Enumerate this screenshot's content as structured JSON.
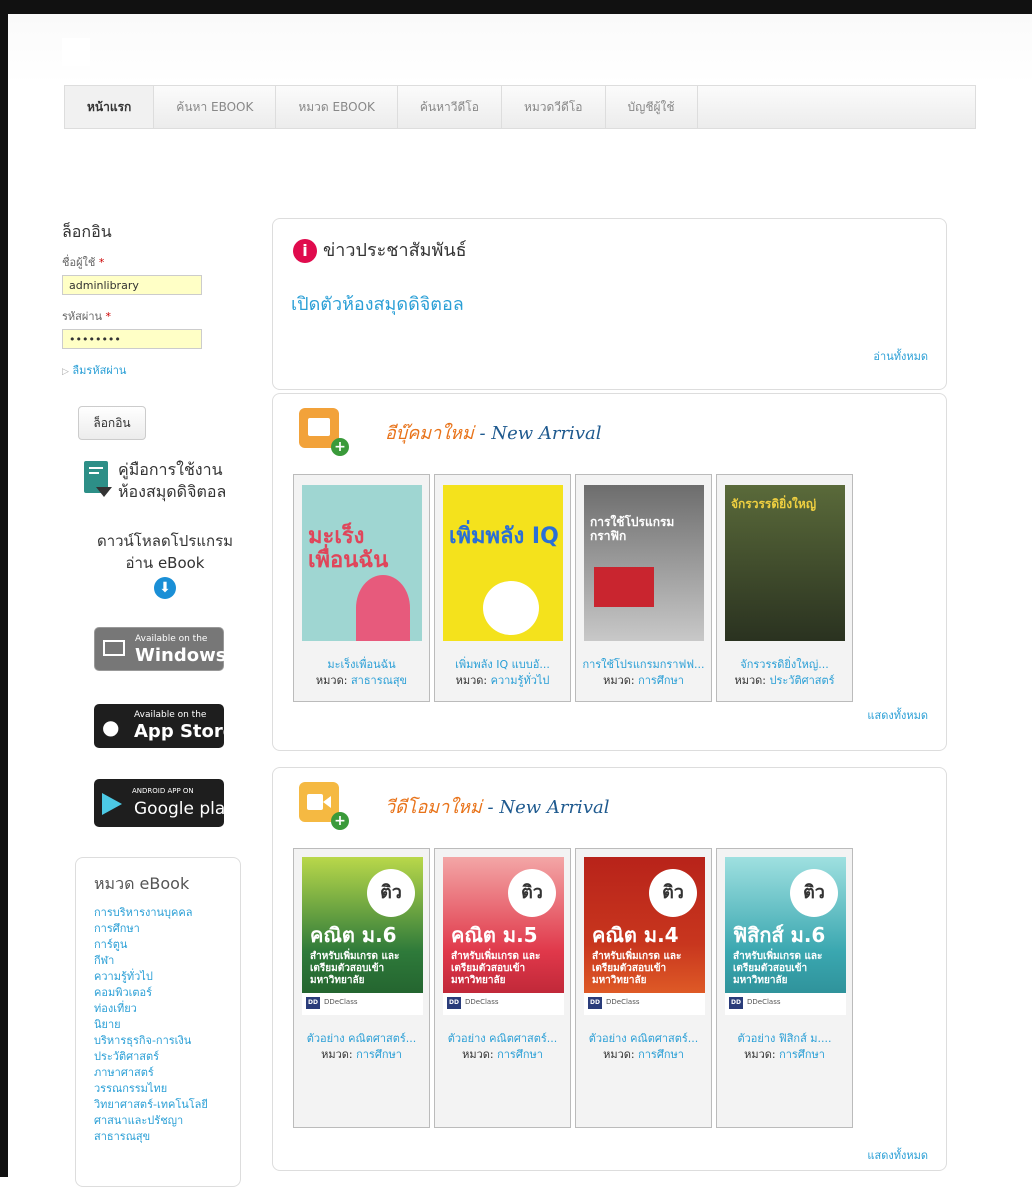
{
  "nav": [
    "หน้าแรก",
    "ค้นหา EBOOK",
    "หมวด EBOOK",
    "ค้นหาวีดีโอ",
    "หมวดวีดีโอ",
    "บัญชีผู้ใช้"
  ],
  "login": {
    "title": "ล็อกอิน",
    "username_label": "ชื่อผู้ใช้",
    "username_value": "adminlibrary",
    "password_label": "รหัสผ่าน",
    "password_value": "••••••••",
    "required_mark": "*",
    "forgot": "ลืมรหัสผ่าน",
    "button": "ล็อกอิน"
  },
  "manual": {
    "line1": "คู่มือการใช้งาน",
    "line2": "ห้องสมุดดิจิตอล"
  },
  "download": {
    "line1": "ดาวน์โหลดโปรแกรม",
    "line2": "อ่าน eBook"
  },
  "stores": {
    "windows": {
      "small": "Available on the",
      "big": "Windows"
    },
    "apple": {
      "small": "Available on the",
      "big": "App Store"
    },
    "google": {
      "small": "ANDROID APP ON",
      "big": "Google play"
    }
  },
  "categories": {
    "title": "หมวด eBook",
    "items": [
      "การบริหารงานบุคคล",
      "การศึกษา",
      "การ์ตูน",
      "กีฬา",
      "ความรู้ทั่วไป",
      "คอมพิวเตอร์",
      "ท่องเที่ยว",
      "นิยาย",
      "บริหารธุรกิจ-การเงิน",
      "ประวัติศาสตร์",
      "ภาษาศาสตร์",
      "วรรณกรรมไทย",
      "วิทยาศาสตร์-เทคโนโลยี",
      "ศาสนาและปรัชญา",
      "สาธารณสุข"
    ]
  },
  "news": {
    "title": "ข่าวประชาสัมพันธ์",
    "headline": "เปิดตัวห้องสมุดดิจิตอล",
    "read_all": "อ่านทั้งหมด"
  },
  "ebooks": {
    "title_th": "อีบุ๊คมาใหม่",
    "title_en": "- New Arrival",
    "show_all": "แสดงทั้งหมด",
    "category_prefix": "หมวด:",
    "items": [
      {
        "title": "มะเร็งเพื่อนฉัน",
        "category": "สาธารณสุข",
        "cover_text": "มะเร็ง เพื่อนฉัน",
        "color": "#9fd6d2"
      },
      {
        "title": "เพิ่มพลัง IQ แบบอั...",
        "category": "ความรู้ทั่วไป",
        "cover_text": "เพิ่มพลัง IQ",
        "color": "#f4e21c"
      },
      {
        "title": "การใช้โปรแกรมกราฟฟ...",
        "category": "การศึกษา",
        "cover_text": "การใช้โปรแกรมกราฟิก",
        "color": "#8a8a8a"
      },
      {
        "title": "จักรวรรดิยิ่งใหญ่...",
        "category": "ประวัติศาสตร์",
        "cover_text": "จักรวรรดิยิ่งใหญ่",
        "color": "#3c4a2a"
      }
    ]
  },
  "videos": {
    "title_th": "วีดีโอมาใหม่",
    "title_en": "- New Arrival",
    "show_all": "แสดงทั้งหมด",
    "category_prefix": "หมวด:",
    "badge": "ติว",
    "brand": "DDeClass",
    "items": [
      {
        "title": "ตัวอย่าง คณิตศาสตร์...",
        "category": "การศึกษา",
        "subject": "คณิต ม.6",
        "color": "#2e7a3a",
        "top": "#b9d84a"
      },
      {
        "title": "ตัวอย่าง คณิตศาสตร์...",
        "category": "การศึกษา",
        "subject": "คณิต ม.5",
        "color": "#e0384a",
        "top": "#f3a6a6"
      },
      {
        "title": "ตัวอย่าง คณิตศาสตร์...",
        "category": "การศึกษา",
        "subject": "คณิต ม.4",
        "color": "#b8231a",
        "top": "#e86a2a"
      },
      {
        "title": "ตัวอย่าง ฟิสิกส์ ม....",
        "category": "การศึกษา",
        "subject": "ฟิสิกส์ ม.6",
        "color": "#3aa7b0",
        "top": "#9fe0e0"
      }
    ],
    "desc": "สำหรับเพิ่มเกรด และ เตรียมตัวสอบเข้า มหาวิทยาลัย"
  }
}
